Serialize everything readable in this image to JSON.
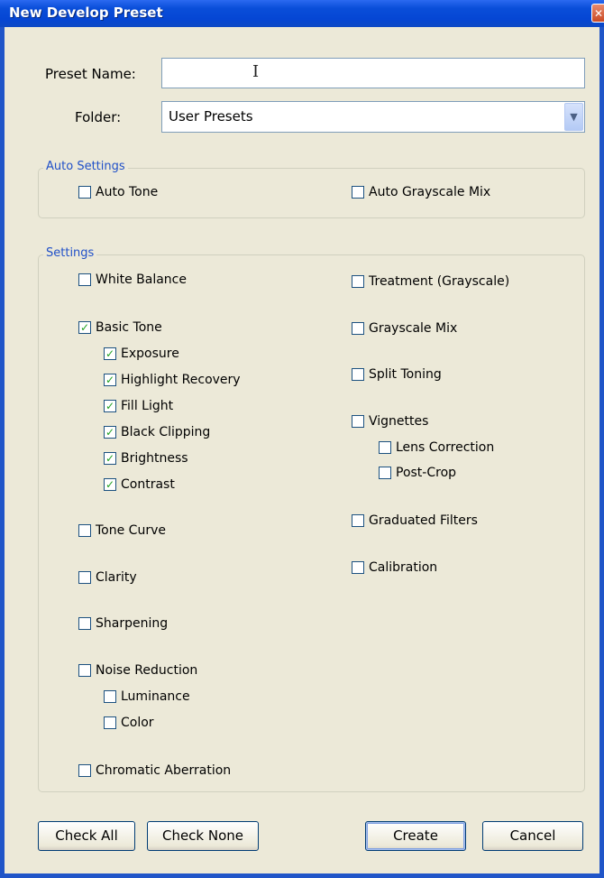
{
  "window": {
    "title": "New Develop Preset",
    "close_glyph": "✕"
  },
  "preset_name": {
    "label": "Preset Name:",
    "value": "",
    "placeholder": ""
  },
  "folder": {
    "label": "Folder:",
    "value": "User Presets"
  },
  "auto_settings": {
    "title": "Auto Settings",
    "items": [
      {
        "label": "Auto Tone",
        "checked": false
      },
      {
        "label": "Auto Grayscale Mix",
        "checked": false
      }
    ]
  },
  "settings": {
    "title": "Settings",
    "left": [
      {
        "label": "White Balance",
        "checked": false
      },
      {
        "label": "Basic Tone",
        "checked": true
      },
      {
        "label": "Exposure",
        "checked": true
      },
      {
        "label": "Highlight Recovery",
        "checked": true
      },
      {
        "label": "Fill Light",
        "checked": true
      },
      {
        "label": "Black Clipping",
        "checked": true
      },
      {
        "label": "Brightness",
        "checked": true
      },
      {
        "label": "Contrast",
        "checked": true
      },
      {
        "label": "Tone Curve",
        "checked": false
      },
      {
        "label": "Clarity",
        "checked": false
      },
      {
        "label": "Sharpening",
        "checked": false
      },
      {
        "label": "Noise Reduction",
        "checked": false
      },
      {
        "label": "Luminance",
        "checked": false
      },
      {
        "label": "Color",
        "checked": false
      },
      {
        "label": "Chromatic Aberration",
        "checked": false
      }
    ],
    "right": [
      {
        "label": "Treatment (Grayscale)",
        "checked": false
      },
      {
        "label": "Grayscale Mix",
        "checked": false
      },
      {
        "label": "Split Toning",
        "checked": false
      },
      {
        "label": "Vignettes",
        "checked": false
      },
      {
        "label": "Lens Correction",
        "checked": false
      },
      {
        "label": "Post-Crop",
        "checked": false
      },
      {
        "label": "Graduated Filters",
        "checked": false
      },
      {
        "label": "Calibration",
        "checked": false
      }
    ]
  },
  "buttons": {
    "check_all": "Check All",
    "check_none": "Check None",
    "create": "Create",
    "cancel": "Cancel"
  },
  "colors": {
    "titlebar": "#0a4ed9",
    "dialog_bg": "#ece9d8",
    "group_title": "#2050c8",
    "check": "#21a121"
  },
  "icons": {
    "dropdown": "chevron-down-icon",
    "close": "close-icon",
    "cursor": "text-cursor-icon"
  }
}
